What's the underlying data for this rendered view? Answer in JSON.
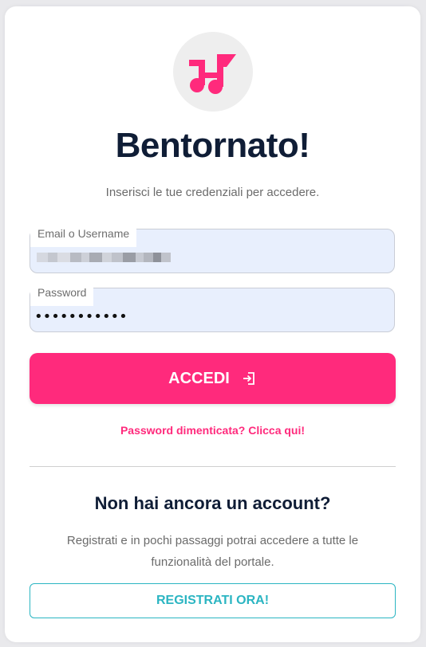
{
  "brand": {
    "logo_icon": "music-note-flag-icon",
    "accent_color": "#ff2a7c",
    "secondary_color": "#2bb5c2",
    "heading_color": "#0f1d36"
  },
  "login": {
    "title": "Bentornato!",
    "subtitle": "Inserisci le tue credenziali per accedere.",
    "email_label": "Email o Username",
    "email_value": "",
    "password_label": "Password",
    "password_value": "•••••••••••",
    "submit_label": "ACCEDI",
    "submit_icon": "login-arrow-icon",
    "forgot_link": "Password dimenticata? Clicca qui!"
  },
  "register": {
    "heading": "Non hai ancora un account?",
    "description": "Registrati e in pochi passaggi potrai accedere a tutte le funzionalità del portale.",
    "button_label": "REGISTRATI ORA!"
  }
}
